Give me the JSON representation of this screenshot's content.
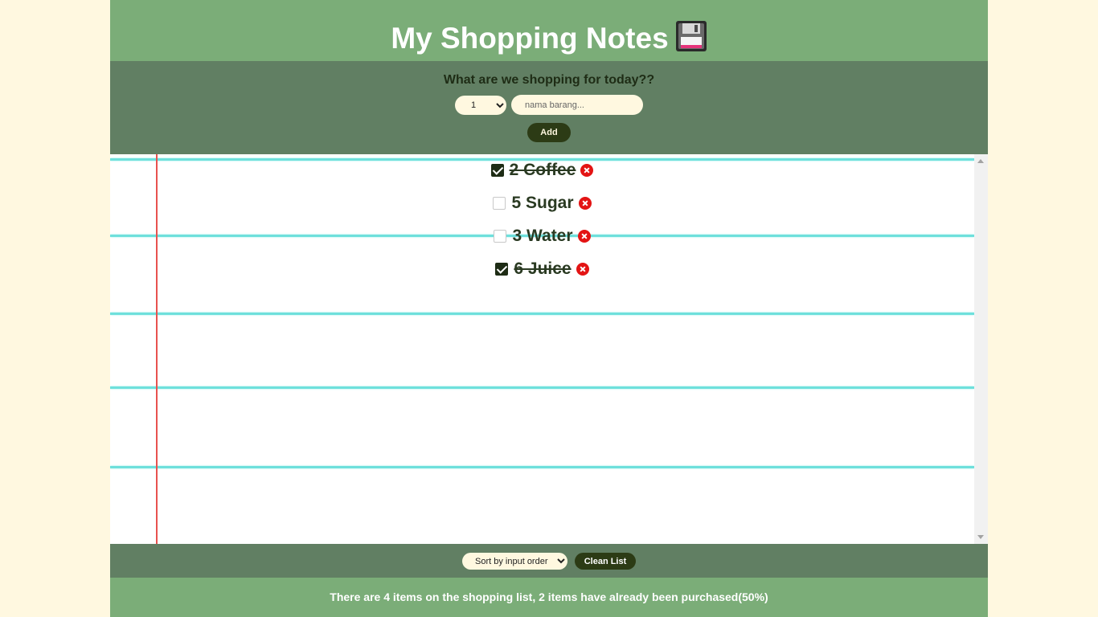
{
  "header": {
    "title": "My Shopping Notes",
    "icon": "floppy-disk-icon"
  },
  "form": {
    "prompt": "What are we shopping for today??",
    "quantity_value": "1",
    "name_placeholder": "nama barang...",
    "add_label": "Add"
  },
  "items": [
    {
      "quantity": "2",
      "name": "Coffee",
      "label": "2 Coffee",
      "checked": true
    },
    {
      "quantity": "5",
      "name": "Sugar",
      "label": "5 Sugar",
      "checked": false
    },
    {
      "quantity": "3",
      "name": "Water",
      "label": "3 Water",
      "checked": false
    },
    {
      "quantity": "6",
      "name": "Juice",
      "label": "6 Juice",
      "checked": true
    }
  ],
  "controls": {
    "sort_value": "Sort by input order",
    "clean_label": "Clean List"
  },
  "stats": {
    "text": "There are 4 items on the shopping list, 2 items have already been purchased(50%)"
  },
  "colors": {
    "background": "#fff8e0",
    "header": "#7bad78",
    "panel": "#617f63",
    "button": "#2c3b15",
    "delete": "#e31414",
    "paper_line": "#6ee0dc",
    "margin_line": "#e8524f"
  }
}
